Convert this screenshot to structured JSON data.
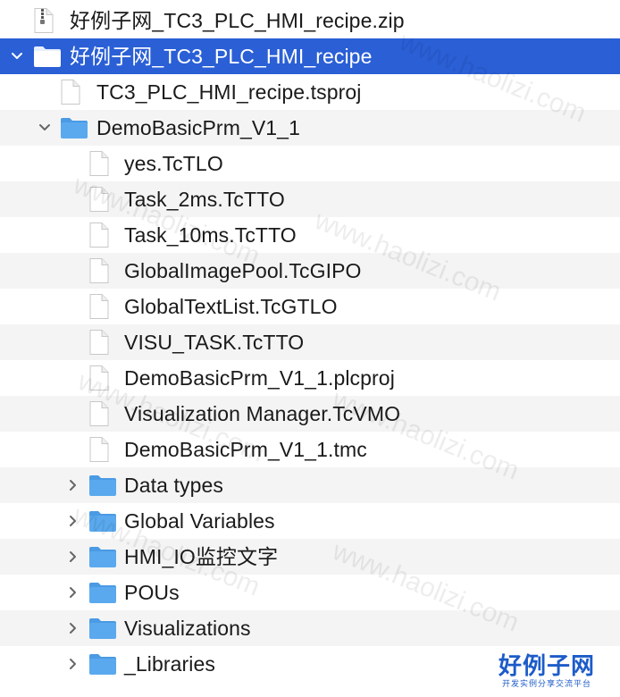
{
  "tree": [
    {
      "label": "好例子网_TC3_PLC_HMI_recipe.zip",
      "icon": "zip-file-icon",
      "level": 0,
      "disclosure": "none",
      "alt": false,
      "selected": false
    },
    {
      "label": "好例子网_TC3_PLC_HMI_recipe",
      "icon": "folder-icon",
      "level": 0,
      "disclosure": "expanded",
      "alt": false,
      "selected": true
    },
    {
      "label": "TC3_PLC_HMI_recipe.tsproj",
      "icon": "file-icon",
      "level": 1,
      "disclosure": "none",
      "alt": false,
      "selected": false
    },
    {
      "label": "DemoBasicPrm_V1_1",
      "icon": "folder-icon",
      "level": 1,
      "disclosure": "expanded",
      "alt": true,
      "selected": false
    },
    {
      "label": "yes.TcTLO",
      "icon": "file-icon",
      "level": 2,
      "disclosure": "none",
      "alt": false,
      "selected": false
    },
    {
      "label": "Task_2ms.TcTTO",
      "icon": "file-icon",
      "level": 2,
      "disclosure": "none",
      "alt": true,
      "selected": false
    },
    {
      "label": "Task_10ms.TcTTO",
      "icon": "file-icon",
      "level": 2,
      "disclosure": "none",
      "alt": false,
      "selected": false
    },
    {
      "label": "GlobalImagePool.TcGIPO",
      "icon": "file-icon",
      "level": 2,
      "disclosure": "none",
      "alt": true,
      "selected": false
    },
    {
      "label": "GlobalTextList.TcGTLO",
      "icon": "file-icon",
      "level": 2,
      "disclosure": "none",
      "alt": false,
      "selected": false
    },
    {
      "label": "VISU_TASK.TcTTO",
      "icon": "file-icon",
      "level": 2,
      "disclosure": "none",
      "alt": true,
      "selected": false
    },
    {
      "label": "DemoBasicPrm_V1_1.plcproj",
      "icon": "file-icon",
      "level": 2,
      "disclosure": "none",
      "alt": false,
      "selected": false
    },
    {
      "label": "Visualization Manager.TcVMO",
      "icon": "file-icon",
      "level": 2,
      "disclosure": "none",
      "alt": true,
      "selected": false
    },
    {
      "label": "DemoBasicPrm_V1_1.tmc",
      "icon": "file-icon",
      "level": 2,
      "disclosure": "none",
      "alt": false,
      "selected": false
    },
    {
      "label": "Data types",
      "icon": "folder-icon",
      "level": 2,
      "disclosure": "collapsed",
      "alt": true,
      "selected": false
    },
    {
      "label": "Global Variables",
      "icon": "folder-icon",
      "level": 2,
      "disclosure": "collapsed",
      "alt": false,
      "selected": false
    },
    {
      "label": "HMI_IO监控文字",
      "icon": "folder-icon",
      "level": 2,
      "disclosure": "collapsed",
      "alt": true,
      "selected": false
    },
    {
      "label": "POUs",
      "icon": "folder-icon",
      "level": 2,
      "disclosure": "collapsed",
      "alt": false,
      "selected": false
    },
    {
      "label": "Visualizations",
      "icon": "folder-icon",
      "level": 2,
      "disclosure": "collapsed",
      "alt": true,
      "selected": false
    },
    {
      "label": "_Libraries",
      "icon": "folder-icon",
      "level": 2,
      "disclosure": "collapsed",
      "alt": false,
      "selected": false
    }
  ],
  "watermark": {
    "title": "好例子网",
    "subtitle": "开发实例分享交流平台",
    "url": "www.haolizi.com"
  },
  "colors": {
    "selection": "#2a5fd6",
    "folder": "#5aa9ee",
    "watermark": "#1c5cc8"
  }
}
